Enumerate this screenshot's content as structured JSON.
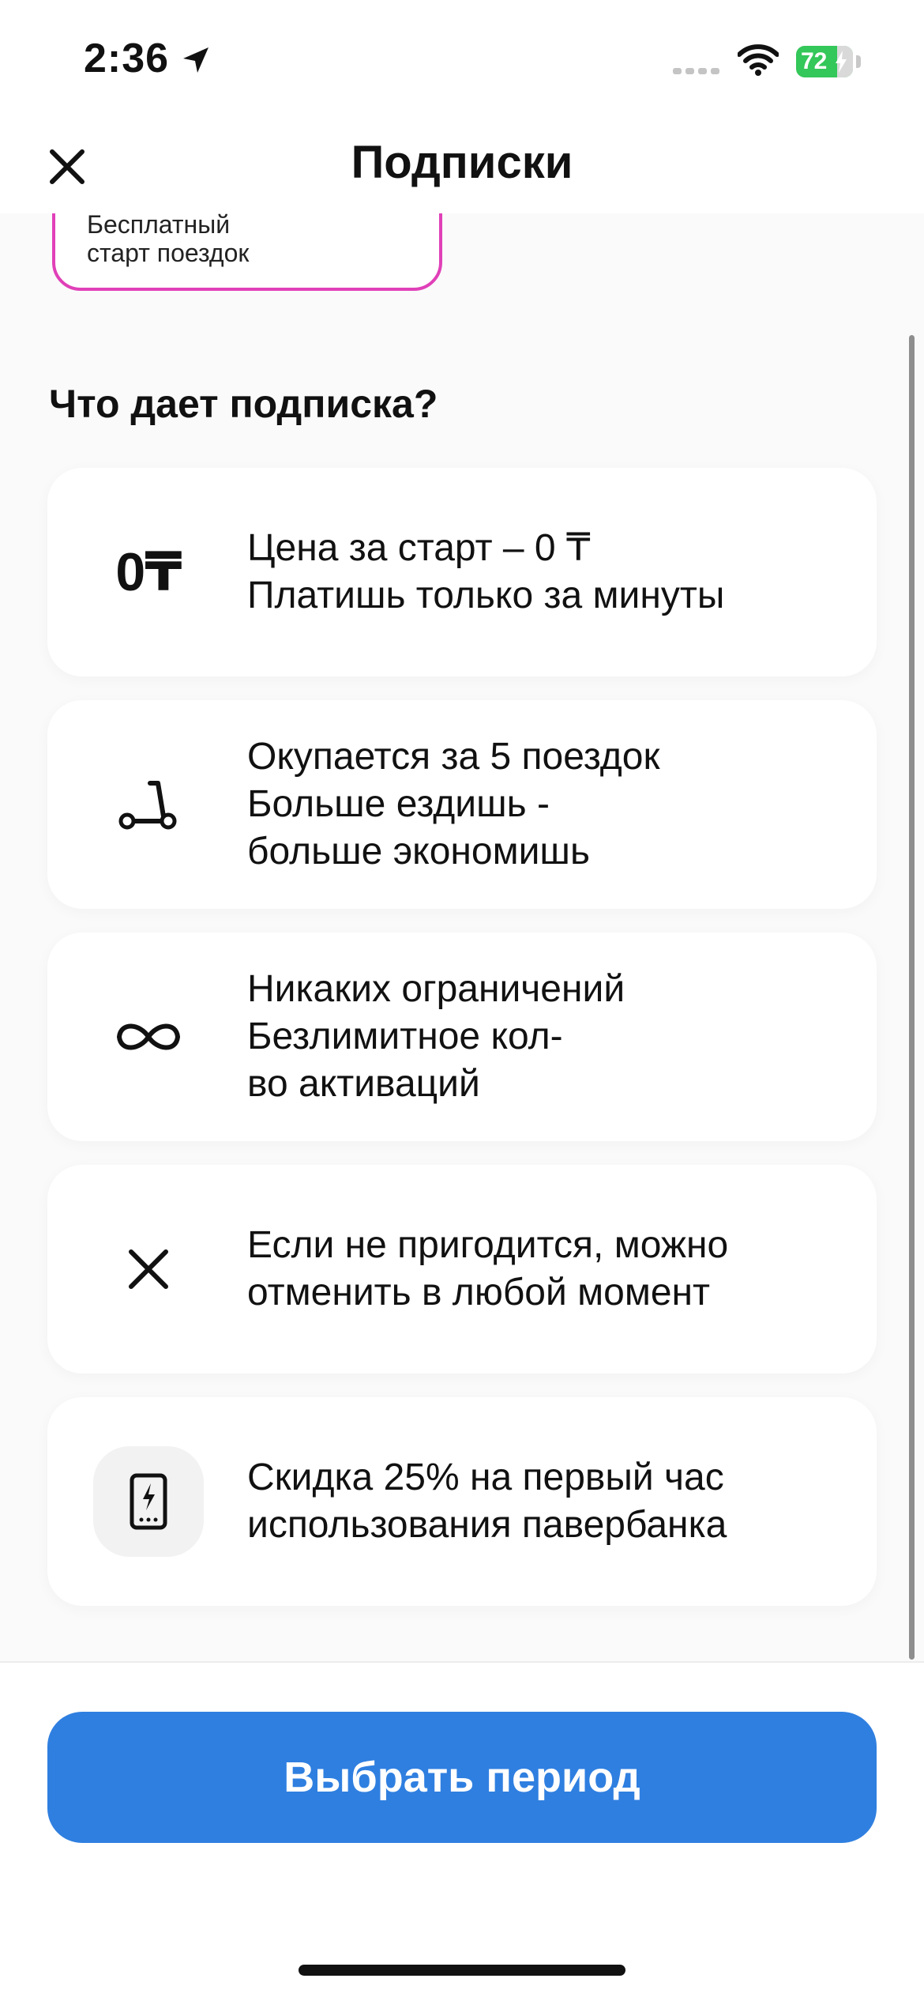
{
  "status_bar": {
    "time": "2:36",
    "battery": "72",
    "icons": [
      "location-arrow-icon",
      "signal-icon",
      "wifi-icon",
      "battery-icon"
    ]
  },
  "header": {
    "title": "Подписки",
    "close_icon": "close-icon"
  },
  "plan_card": {
    "line1": "Бесплатный",
    "line2": "старт поездок",
    "border_color": "#e040b8"
  },
  "section": {
    "title": "Что дает подписка?"
  },
  "features": [
    {
      "icon": "zero-price-icon",
      "icon_text": "0₸",
      "line1": "Цена за старт – 0 ₸",
      "line2": "Платишь только за минуты",
      "line3": ""
    },
    {
      "icon": "scooter-icon",
      "line1": "Окупается за 5 поездок",
      "line2": "Больше ездишь -",
      "line3": "больше экономишь"
    },
    {
      "icon": "infinity-icon",
      "line1": "Никаких ограничений",
      "line2": "Безлимитное кол-",
      "line3": "во активаций"
    },
    {
      "icon": "cancel-icon",
      "line1": "Если не пригодится, можно",
      "line2": "отменить в любой момент",
      "line3": ""
    },
    {
      "icon": "powerbank-icon",
      "line1": "Скидка 25% на первый час",
      "line2": "использования павербанка",
      "line3": ""
    }
  ],
  "footer": {
    "button_label": "Выбрать период",
    "button_color": "#2f7fe0"
  }
}
